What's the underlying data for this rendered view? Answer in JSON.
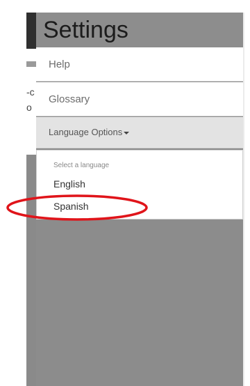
{
  "background": {
    "text_line_1": "-c",
    "text_line_2": "o"
  },
  "drawer": {
    "title": "Settings",
    "items": [
      {
        "label": "Help"
      },
      {
        "label": "Glossary"
      },
      {
        "label": "Language Options"
      }
    ]
  },
  "language_menu": {
    "header": "Select a language",
    "options": [
      "English",
      "Spanish"
    ]
  },
  "colors": {
    "drawer_title_bg": "#8d8d8d",
    "annotation": "#e0141a"
  }
}
